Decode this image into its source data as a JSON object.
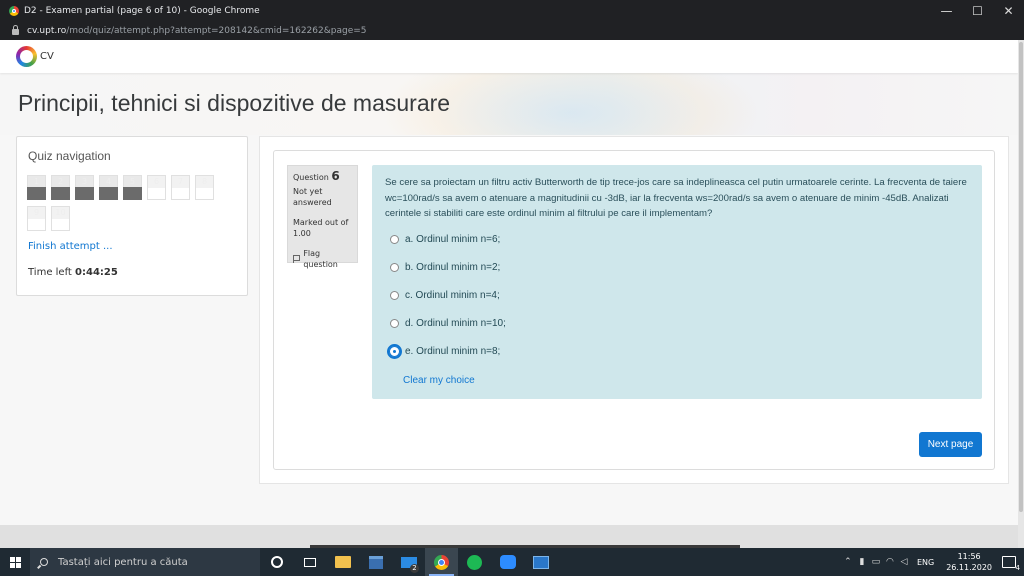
{
  "window": {
    "title": "D2 - Examen partial (page 6 of 10) - Google Chrome",
    "url_host": "cv.upt.ro",
    "url_path": "/mod/quiz/attempt.php?attempt=208142&cmid=162262&page=5",
    "controls": {
      "minimize": "—",
      "maximize": "☐",
      "close": "✕"
    }
  },
  "site": {
    "logo_text": "CV"
  },
  "course": {
    "title": "Principii, tehnici si dispozitive de masurare"
  },
  "quiz_nav": {
    "heading": "Quiz navigation",
    "questions": [
      {
        "num": "1",
        "answered": true
      },
      {
        "num": "2",
        "answered": true
      },
      {
        "num": "3",
        "answered": true
      },
      {
        "num": "4",
        "answered": true
      },
      {
        "num": "5",
        "answered": true
      },
      {
        "num": "6",
        "answered": false
      },
      {
        "num": "7",
        "answered": false
      },
      {
        "num": "8",
        "answered": false
      },
      {
        "num": "9",
        "answered": false
      },
      {
        "num": "10",
        "answered": false
      }
    ],
    "finish_link": "Finish attempt ...",
    "time_left_label": "Time left",
    "time_left_value": "0:44:25"
  },
  "question": {
    "label": "Question",
    "number": "6",
    "state": "Not yet answered",
    "grade": "Marked out of 1.00",
    "flag": "Flag question",
    "text": "Se cere sa proiectam un filtru activ Butterworth de tip trece-jos care sa indeplineasca cel putin urmatoarele cerinte. La frecventa de taiere wc=100rad/s sa avem o atenuare a magnitudinii cu -3dB, iar la frecventa ws=200rad/s sa avem o atenuare de minim -45dB. Analizati cerintele si stabiliti care este ordinul minim al filtrului pe care il implementam?",
    "answers": [
      {
        "label": "a. Ordinul minim n=6;",
        "selected": false
      },
      {
        "label": "b. Ordinul minim n=2;",
        "selected": false
      },
      {
        "label": "c. Ordinul minim n=4;",
        "selected": false
      },
      {
        "label": "d. Ordinul minim n=10;",
        "selected": false
      },
      {
        "label": "e. Ordinul minim n=8;",
        "selected": true
      }
    ],
    "clear_choice": "Clear my choice"
  },
  "next_button": "Next page",
  "taskbar": {
    "search_placeholder": "Tastați aici pentru a căuta",
    "mail_badge": "2",
    "lang": "ENG",
    "time": "11:56",
    "date": "26.11.2020",
    "notifications": "4"
  },
  "colors": {
    "accent": "#1177d1",
    "formulation_bg": "#cfe7eb",
    "answered_box": "#6b6b6b"
  }
}
